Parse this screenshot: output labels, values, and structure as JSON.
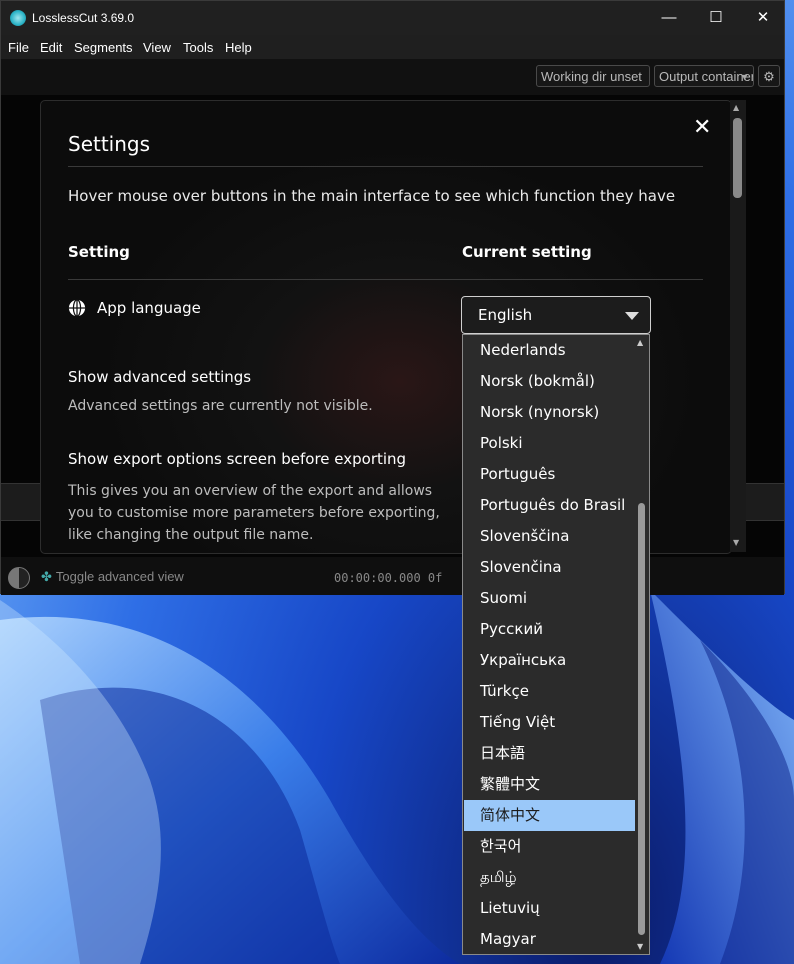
{
  "window": {
    "title": "LosslessCut 3.69.0",
    "controls": {
      "minimize": "—",
      "maximize": "☐",
      "close": "✕"
    }
  },
  "menu": [
    "File",
    "Edit",
    "Segments",
    "View",
    "Tools",
    "Help"
  ],
  "toolbar": {
    "working_dir": "Working dir unset",
    "output_container": "Output container",
    "settings_icon": "gear-icon"
  },
  "settings": {
    "title": "Settings",
    "close_glyph": "✕",
    "description": "Hover mouse over buttons in the main interface to see which function they have",
    "header_setting": "Setting",
    "header_current": "Current setting",
    "app_language_label": "App language",
    "language_value": "English",
    "advanced_label": "Show advanced settings",
    "advanced_desc": "Advanced settings are currently not visible.",
    "export_label": "Show export options screen before exporting",
    "export_desc": "This gives you an overview of the export and allows you to customise more parameters before exporting, like changing the output file name."
  },
  "bottom": {
    "toggle_advanced": "Toggle advanced view",
    "timecode": "00:00:00.000 0f"
  },
  "language_options": [
    "Nederlands",
    "Norsk (bokmål)",
    "Norsk (nynorsk)",
    "Polski",
    "Português",
    "Português do Brasil",
    "Slovenščina",
    "Slovenčina",
    "Suomi",
    "Русский",
    "Українська",
    "Türkçe",
    "Tiếng Việt",
    "日本語",
    "繁體中文",
    "简体中文",
    "한국어",
    "தமிழ்",
    "Lietuvių",
    "Magyar"
  ],
  "highlighted_option": "简体中文",
  "colors": {
    "highlight": "#9ac8f9",
    "accent": "#2bb3c6"
  }
}
